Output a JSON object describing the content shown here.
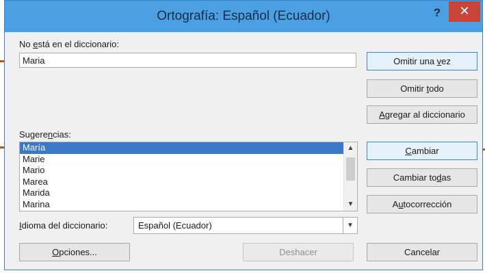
{
  "window": {
    "title": "Ortografía: Español (Ecuador)",
    "help": "?",
    "close": "✕"
  },
  "not_in_dictionary": {
    "label_pre": "No ",
    "label_u": "e",
    "label_post": "stá en el diccionario:",
    "value": "Maria"
  },
  "suggestions": {
    "label_pre": "Sugere",
    "label_u": "n",
    "label_post": "cias:",
    "items": [
      "María",
      "Marie",
      "Mario",
      "Marea",
      "Marida",
      "Marina"
    ],
    "selected_index": 0
  },
  "language": {
    "label_u": "I",
    "label_post": "dioma del diccionario:",
    "value": "Español (Ecuador)"
  },
  "buttons": {
    "ignore_once": {
      "pre": "Omitir una ",
      "u": "v",
      "post": "ez"
    },
    "ignore_all": {
      "pre": "Omitir ",
      "u": "t",
      "post": "odo"
    },
    "add_dictionary": {
      "pre": "",
      "u": "A",
      "post": "gregar al diccionario"
    },
    "change": {
      "pre": "",
      "u": "C",
      "post": "ambiar"
    },
    "change_all": {
      "pre": "Cambiar to",
      "u": "d",
      "post": "as"
    },
    "autocorrect": {
      "pre": "A",
      "u": "u",
      "post": "tocorrección"
    },
    "options": {
      "pre": "",
      "u": "O",
      "post": "pciones..."
    },
    "undo": "Deshacer",
    "cancel": "Cancelar"
  },
  "colors": {
    "titlebar": "#4aa0e2",
    "close": "#c8453a",
    "selection": "#3c78c8",
    "marker": "#c0511f"
  },
  "icons": {
    "scroll_up": "chevron-up-icon",
    "scroll_down": "chevron-down-icon",
    "dropdown": "chevron-down-icon"
  }
}
